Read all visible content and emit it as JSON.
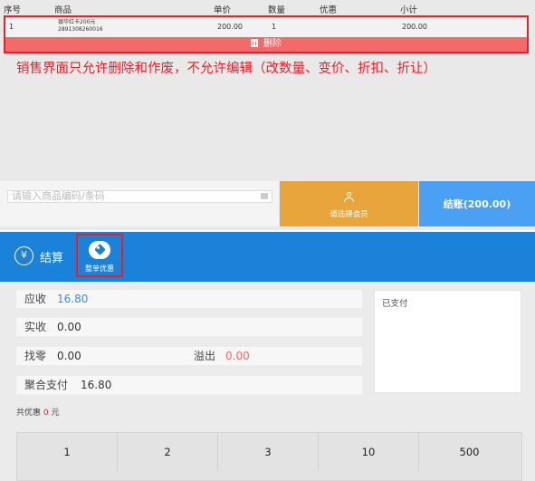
{
  "table": {
    "headers": {
      "index": "序号",
      "goods": "商品",
      "price": "单价",
      "qty": "数量",
      "discount": "优惠",
      "subtotal": "小计"
    },
    "rows": [
      {
        "index": "1",
        "name": "银华红卡200元",
        "code": "2891308260016",
        "price": "200.00",
        "qty": "1",
        "subtotal": "200.00"
      }
    ],
    "delete_label": "删除"
  },
  "annotation": "销售界面只允许删除和作废，不允许编辑（改数量、变价、折扣、折让）",
  "bottom_bar": {
    "search_placeholder": "请输入商品编码/条码",
    "member_label": "请选择会员",
    "checkout_label": "结账(200.00)"
  },
  "payment": {
    "settle_label": "结算",
    "settle_icon": "¥",
    "discount_button_label": "整单优惠",
    "receivable_label": "应收",
    "receivable_value": "16.80",
    "received_label": "实收",
    "received_value": "0.00",
    "change_label": "找零",
    "change_value": "0.00",
    "overflow_label": "溢出",
    "overflow_value": "0.00",
    "aggregate_label": "聚合支付",
    "aggregate_value": "16.80",
    "paid_label": "已支付",
    "total_discount_prefix": "共优惠",
    "total_discount_value": "0",
    "total_discount_unit": "元"
  },
  "keypad": [
    "1",
    "2",
    "3",
    "10",
    "500"
  ],
  "colors": {
    "header_blue": "#1a82d8",
    "checkout_blue": "#4aa1f3",
    "member_orange": "#e8a53c",
    "delete_red": "#f36a6a",
    "annotation_red": "#e8202a",
    "value_blue": "#3d8fdb",
    "overflow_red": "#ef6b6b"
  }
}
